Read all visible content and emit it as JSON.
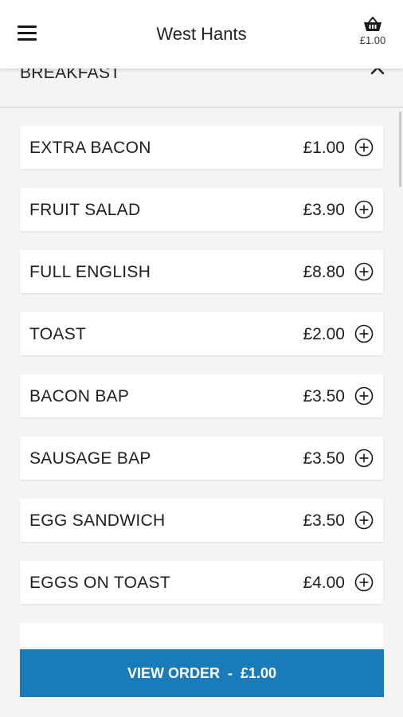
{
  "header": {
    "title": "West Hants",
    "menu_icon": "hamburger-menu-icon",
    "basket_icon": "basket-icon",
    "basket_total": "£1.00"
  },
  "section": {
    "title": "BREAKFAST",
    "toggle_icon": "chevron-up-icon"
  },
  "items": [
    {
      "name": "EXTRA BACON",
      "price": "£1.00"
    },
    {
      "name": "FRUIT SALAD",
      "price": "£3.90"
    },
    {
      "name": "FULL ENGLISH",
      "price": "£8.80"
    },
    {
      "name": "TOAST",
      "price": "£2.00"
    },
    {
      "name": "BACON BAP",
      "price": "£3.50"
    },
    {
      "name": "SAUSAGE BAP",
      "price": "£3.50"
    },
    {
      "name": "EGG SANDWICH",
      "price": "£3.50"
    },
    {
      "name": "EGGS ON TOAST",
      "price": "£4.00"
    }
  ],
  "add_icon": "plus-circle-icon",
  "view_order": {
    "label": "VIEW ORDER",
    "separator": "-",
    "total": "£1.00"
  },
  "colors": {
    "accent": "#1a7bbb",
    "background": "#f4f4f4",
    "card": "#ffffff"
  }
}
